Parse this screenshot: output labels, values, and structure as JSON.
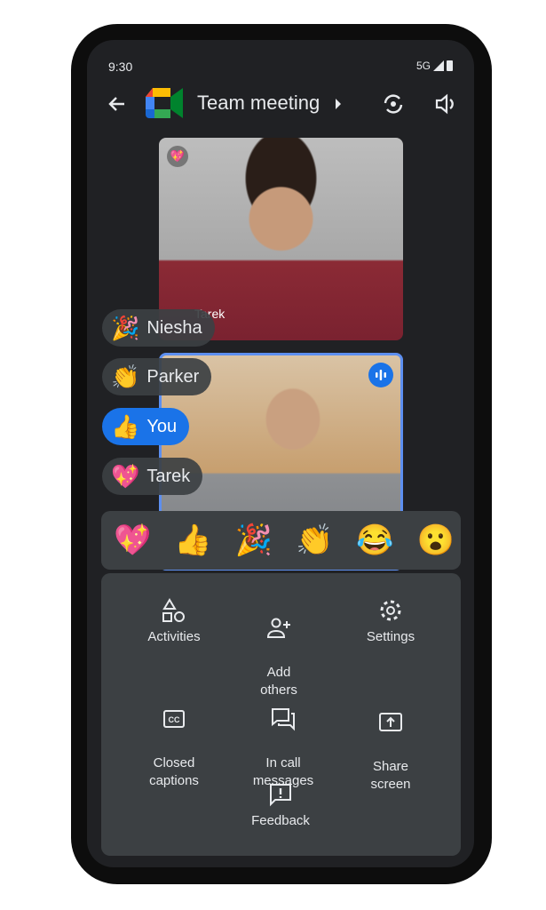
{
  "status": {
    "time": "9:30",
    "network": "5G"
  },
  "header": {
    "title": "Team meeting"
  },
  "tiles": [
    {
      "name_partial": "Tarek"
    },
    {
      "speaking": true
    }
  ],
  "reactions": [
    {
      "emoji": "🎉",
      "name": "Niesha"
    },
    {
      "emoji": "👏",
      "name": "Parker"
    },
    {
      "emoji": "👍",
      "name": "You"
    },
    {
      "emoji": "💖",
      "name": "Tarek"
    }
  ],
  "emoji_bar": [
    "💖",
    "👍",
    "🎉",
    "👏",
    "😂",
    "😮",
    "🤔"
  ],
  "menu": {
    "activities": "Activities",
    "add_others": "Add\nothers",
    "settings": "Settings",
    "closed_captions": "Closed\ncaptions",
    "in_call_messages": "In call\nmessages",
    "share_screen": "Share\nscreen",
    "feedback": "Feedback"
  },
  "colors": {
    "accent": "#1a73e8",
    "background": "#202124",
    "panel": "#3c4043"
  }
}
